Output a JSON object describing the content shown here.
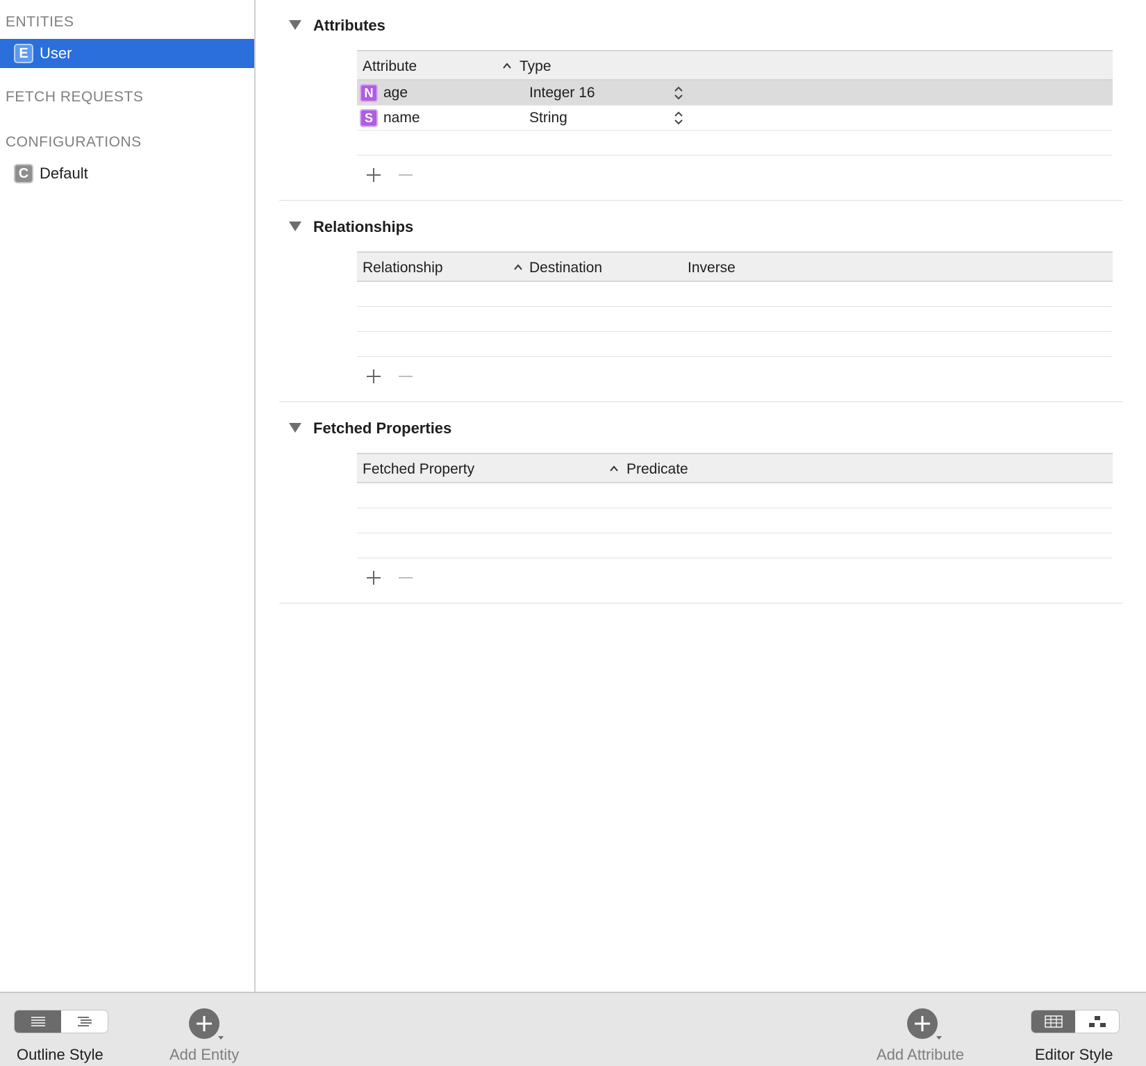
{
  "sidebar": {
    "entities_label": "ENTITIES",
    "entities": [
      {
        "badge": "E",
        "label": "User"
      }
    ],
    "fetch_requests_label": "FETCH REQUESTS",
    "configurations_label": "CONFIGURATIONS",
    "configurations": [
      {
        "badge": "C",
        "label": "Default"
      }
    ]
  },
  "attributes": {
    "title": "Attributes",
    "columns": [
      "Attribute",
      "Type"
    ],
    "rows": [
      {
        "badge": "N",
        "name": "age",
        "type": "Integer 16",
        "selected": true
      },
      {
        "badge": "S",
        "name": "name",
        "type": "String",
        "selected": false
      }
    ]
  },
  "relationships": {
    "title": "Relationships",
    "columns": [
      "Relationship",
      "Destination",
      "Inverse"
    ]
  },
  "fetched_properties": {
    "title": "Fetched Properties",
    "columns": [
      "Fetched Property",
      "Predicate"
    ]
  },
  "toolbar": {
    "outline_style_label": "Outline Style",
    "add_entity_label": "Add Entity",
    "add_attribute_label": "Add Attribute",
    "editor_style_label": "Editor Style"
  },
  "colors": {
    "selection": "#2a6fdb",
    "attribute_badge": "#b05ee0",
    "toolbar_bg": "#e6e6e6"
  }
}
